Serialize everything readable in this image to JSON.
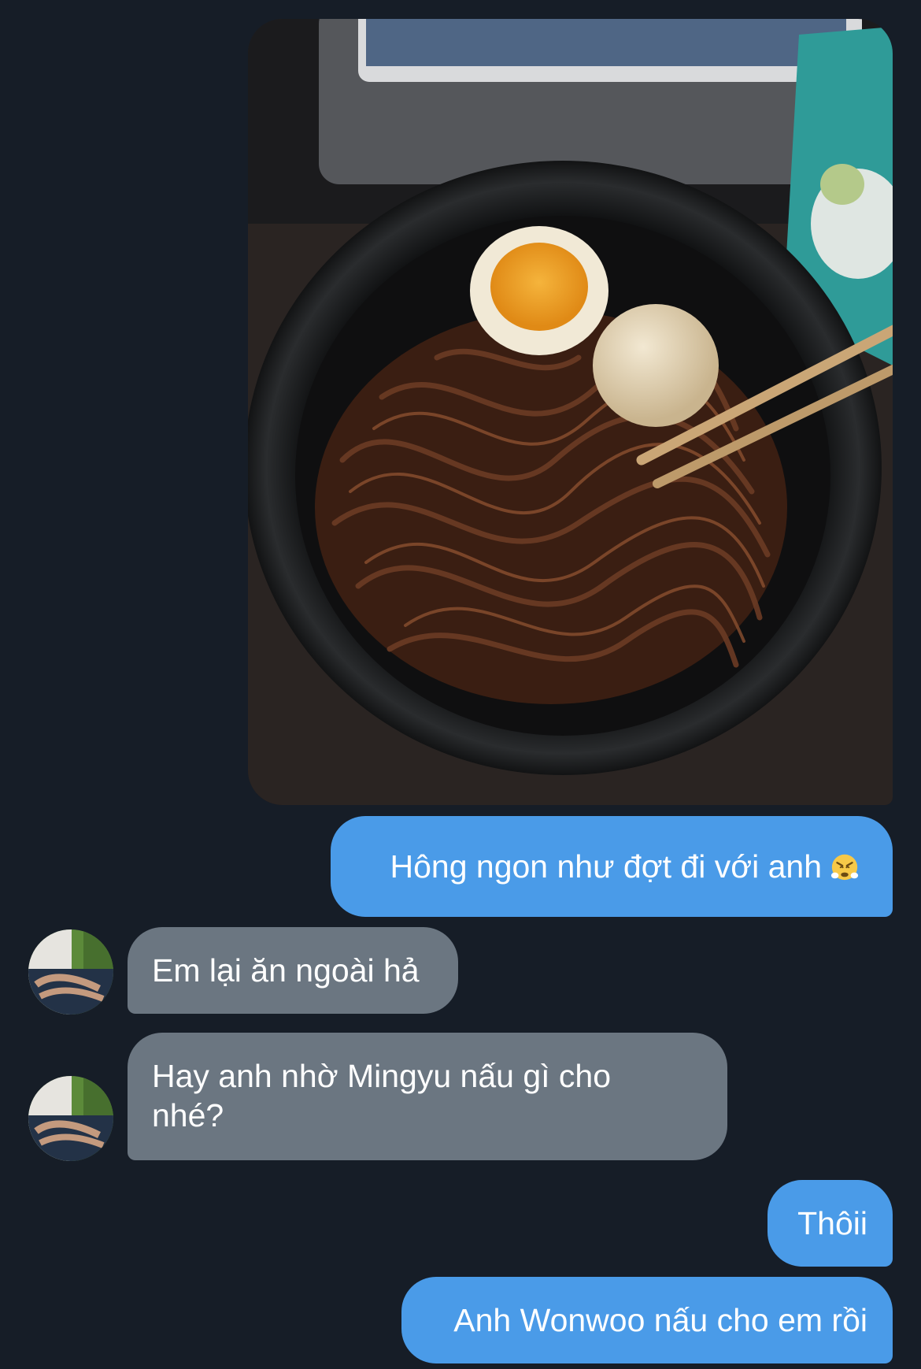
{
  "messages": [
    {
      "type": "image",
      "direction": "outgoing",
      "image_description": "bowl of black bean noodles with two eggs and chopsticks"
    },
    {
      "type": "text",
      "direction": "outgoing",
      "text": "Hông ngon như đợt đi với anh",
      "emoji": "face-with-steam-icon"
    },
    {
      "type": "text",
      "direction": "incoming",
      "text": "Em lại ăn ngoài hả"
    },
    {
      "type": "text",
      "direction": "incoming",
      "text": "Hay anh nhờ Mingyu nấu gì cho nhé?"
    },
    {
      "type": "text",
      "direction": "outgoing",
      "text": "Thôii"
    },
    {
      "type": "text",
      "direction": "outgoing",
      "text": "Anh Wonwoo nấu cho em rồi"
    }
  ],
  "colors": {
    "background": "#161d27",
    "outgoing_bubble": "#4a9be8",
    "incoming_bubble": "#6b7681",
    "text": "#ffffff"
  }
}
